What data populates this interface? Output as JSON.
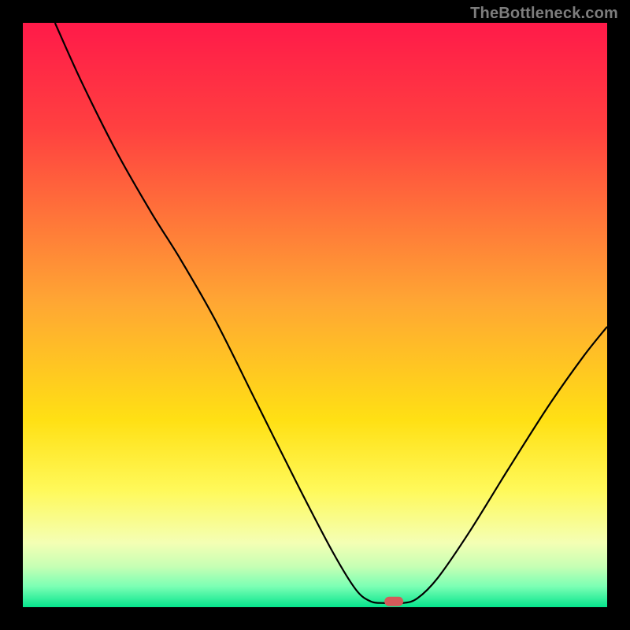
{
  "watermark": "TheBottleneck.com",
  "chart_data": {
    "type": "line",
    "title": "",
    "xlabel": "",
    "ylabel": "",
    "xlim": [
      0,
      100
    ],
    "ylim": [
      0,
      100
    ],
    "gradient_stops": [
      {
        "pct": 0,
        "color": "#ff1a49"
      },
      {
        "pct": 18,
        "color": "#ff4040"
      },
      {
        "pct": 48,
        "color": "#ffa733"
      },
      {
        "pct": 68,
        "color": "#ffe014"
      },
      {
        "pct": 80,
        "color": "#fff95a"
      },
      {
        "pct": 89,
        "color": "#f4ffb4"
      },
      {
        "pct": 93,
        "color": "#c7ffb4"
      },
      {
        "pct": 96.5,
        "color": "#7affb4"
      },
      {
        "pct": 100,
        "color": "#06e58d"
      }
    ],
    "series": [
      {
        "name": "bottleneck-curve",
        "type": "line",
        "points": [
          {
            "x": 5.5,
            "y": 100.0
          },
          {
            "x": 10.0,
            "y": 90.0
          },
          {
            "x": 16.0,
            "y": 78.0
          },
          {
            "x": 22.0,
            "y": 67.5
          },
          {
            "x": 27.0,
            "y": 59.5
          },
          {
            "x": 33.0,
            "y": 49.0
          },
          {
            "x": 40.0,
            "y": 35.0
          },
          {
            "x": 47.0,
            "y": 21.0
          },
          {
            "x": 53.0,
            "y": 9.5
          },
          {
            "x": 57.0,
            "y": 3.0
          },
          {
            "x": 59.5,
            "y": 1.0
          },
          {
            "x": 62.0,
            "y": 0.7
          },
          {
            "x": 65.0,
            "y": 0.7
          },
          {
            "x": 67.5,
            "y": 1.5
          },
          {
            "x": 71.0,
            "y": 5.0
          },
          {
            "x": 76.5,
            "y": 13.0
          },
          {
            "x": 83.0,
            "y": 23.5
          },
          {
            "x": 90.0,
            "y": 34.5
          },
          {
            "x": 96.0,
            "y": 43.0
          },
          {
            "x": 100.0,
            "y": 48.0
          }
        ]
      }
    ],
    "marker": {
      "x": 63.5,
      "y": 1.0,
      "width_pct": 3.2,
      "height_pct": 1.7,
      "color": "#d45a5a"
    }
  }
}
